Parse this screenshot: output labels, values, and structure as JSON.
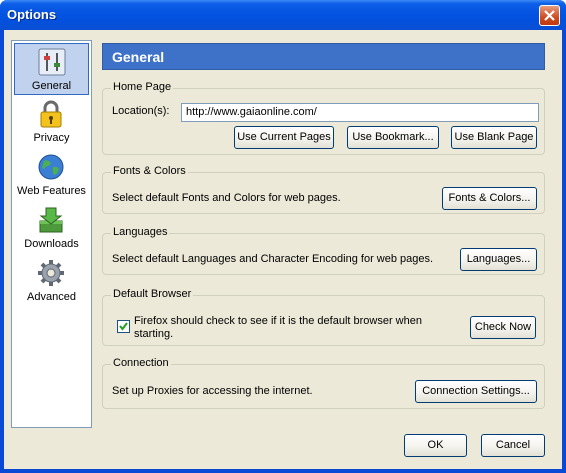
{
  "window": {
    "title": "Options"
  },
  "sidebar": {
    "items": [
      {
        "label": "General",
        "icon": "general-icon",
        "selected": true
      },
      {
        "label": "Privacy",
        "icon": "lock-icon",
        "selected": false
      },
      {
        "label": "Web Features",
        "icon": "globe-icon",
        "selected": false
      },
      {
        "label": "Downloads",
        "icon": "downloads-icon",
        "selected": false
      },
      {
        "label": "Advanced",
        "icon": "gear-icon",
        "selected": false
      }
    ]
  },
  "main": {
    "header": "General",
    "home_page": {
      "legend": "Home Page",
      "location_label": "Location(s):",
      "location_value": "http://www.gaiaonline.com/",
      "use_current": "Use Current Pages",
      "use_bookmark": "Use Bookmark...",
      "use_blank": "Use Blank Page"
    },
    "fonts_colors": {
      "legend": "Fonts & Colors",
      "description": "Select default Fonts and Colors for web pages.",
      "button": "Fonts & Colors..."
    },
    "languages": {
      "legend": "Languages",
      "description": "Select default Languages and Character Encoding for web pages.",
      "button": "Languages..."
    },
    "default_browser": {
      "legend": "Default Browser",
      "checkbox_line1": "Firefox should check to see if it is the default browser when",
      "checkbox_line2": "starting.",
      "checked": true,
      "button": "Check Now"
    },
    "connection": {
      "legend": "Connection",
      "description": "Set up Proxies for accessing the internet.",
      "button": "Connection Settings..."
    }
  },
  "footer": {
    "ok": "OK",
    "cancel": "Cancel"
  },
  "colors": {
    "title_bar": "#0554e2",
    "header_bar": "#3e72c9",
    "face": "#ece9d8",
    "selected_item": "#c1d2ee"
  }
}
